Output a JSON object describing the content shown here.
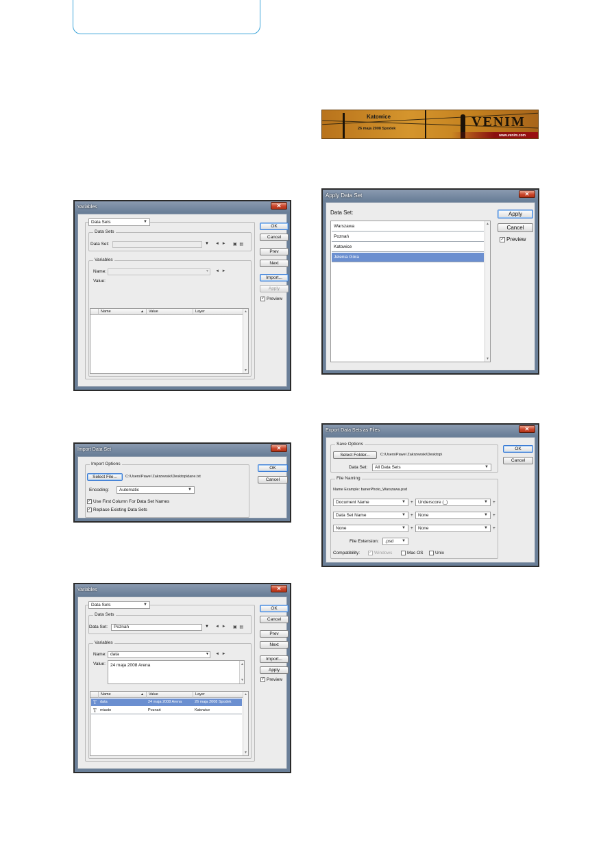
{
  "variables_empty": {
    "title": "Variables",
    "close": "✕",
    "dropdown": "Data Sets",
    "group_datasets": "Data Sets",
    "dataset_label": "Data Set:",
    "dataset_value": "",
    "group_variables": "Variables",
    "name_label": "Name:",
    "value_label": "Value:",
    "columns": [
      "Name",
      "Value",
      "Layer"
    ],
    "buttons": {
      "ok": "OK",
      "cancel": "Cancel",
      "prev": "Prev",
      "next": "Next",
      "import": "Import...",
      "apply": "Apply"
    },
    "preview_label": "Preview",
    "preview_checked": "✓"
  },
  "import_dialog": {
    "title": "Import Data Set",
    "close": "✕",
    "group": "Import Options",
    "select_file": "Select File...",
    "file_path": "C:\\Users\\Pawel Zakrzewski\\Desktop\\dane.txt",
    "encoding_label": "Encoding:",
    "encoding_value": "Automatic",
    "check1": "Use First Column For Data Set Names",
    "check2": "Replace Existing Data Sets",
    "check_mark": "✓",
    "ok": "OK",
    "cancel": "Cancel"
  },
  "variables_filled": {
    "title": "Variables",
    "close": "✕",
    "dropdown": "Data Sets",
    "group_datasets": "Data Sets",
    "dataset_label": "Data Set:",
    "dataset_value": "Poznań",
    "group_variables": "Variables",
    "name_label": "Name:",
    "name_value": "data",
    "value_label": "Value:",
    "value_text": "24 maja 2008 Arena",
    "columns": [
      "Name",
      "Value",
      "Layer"
    ],
    "rows": [
      {
        "icon": "T",
        "name": "data",
        "value": "24 maja 2008 Arena",
        "layer": "26 maja 2008 Spodek"
      },
      {
        "icon": "T",
        "name": "miasto",
        "value": "Poznań",
        "layer": "Katowice"
      }
    ],
    "buttons": {
      "ok": "OK",
      "cancel": "Cancel",
      "prev": "Prev",
      "next": "Next",
      "import": "Import...",
      "apply": "Apply"
    },
    "preview_label": "Preview",
    "preview_checked": "✓"
  },
  "banner": {
    "city": "Katowice",
    "date": "26 maja 2008 Spodek",
    "brand": "VENIM",
    "url": "www.venim.com"
  },
  "apply_dialog": {
    "title": "Apply Data Set",
    "close": "✕",
    "dataset_label": "Data Set:",
    "items": [
      "Warszawa",
      "Poznań",
      "Katowice",
      "Jelenia Góra"
    ],
    "apply": "Apply",
    "cancel": "Cancel",
    "preview_label": "Preview",
    "preview_checked": "✓"
  },
  "export_dialog": {
    "title": "Export Data Sets as Files",
    "close": "✕",
    "group_save": "Save Options",
    "select_folder": "Select Folder...",
    "folder_path": "C:\\Users\\Pawel Zakrzewski\\Desktop\\",
    "dataset_label": "Data Set:",
    "dataset_value": "All Data Sets",
    "group_naming": "File Naming",
    "name_example": "Name Example: banerPhoto_Warszawa.psd",
    "naming_rows": [
      [
        "Document Name",
        "Underscore (_)"
      ],
      [
        "Data Set Name",
        "None"
      ],
      [
        "None",
        "None"
      ]
    ],
    "plus": "+",
    "ext_label": "File Extension:",
    "ext_value": ".psd",
    "compat_label": "Compatibility:",
    "compat_windows": "Windows",
    "compat_mac": "Mac OS",
    "compat_unix": "Unix",
    "check_mark": "✓",
    "ok": "OK",
    "cancel": "Cancel"
  }
}
